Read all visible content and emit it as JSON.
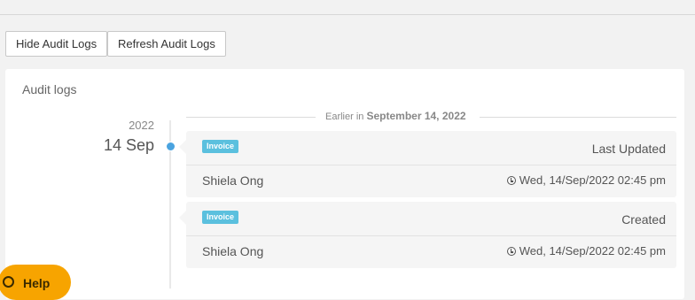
{
  "toolbar": {
    "hide_label": "Hide Audit Logs",
    "refresh_label": "Refresh Audit Logs"
  },
  "panel": {
    "title": "Audit logs",
    "group": {
      "year": "2022",
      "day": "14 Sep",
      "earlier_prefix": "Earlier in",
      "earlier_date": "September 14, 2022"
    },
    "entries": [
      {
        "badge": "Invoice",
        "action": "Last Updated",
        "user": "Shiela Ong",
        "time": "Wed, 14/Sep/2022 02:45 pm"
      },
      {
        "badge": "Invoice",
        "action": "Created",
        "user": "Shiela Ong",
        "time": "Wed, 14/Sep/2022 02:45 pm"
      }
    ]
  },
  "help": {
    "label": "Help"
  },
  "colors": {
    "accent": "#4aa3df",
    "badge": "#5bc0de",
    "help": "#f7a400"
  }
}
